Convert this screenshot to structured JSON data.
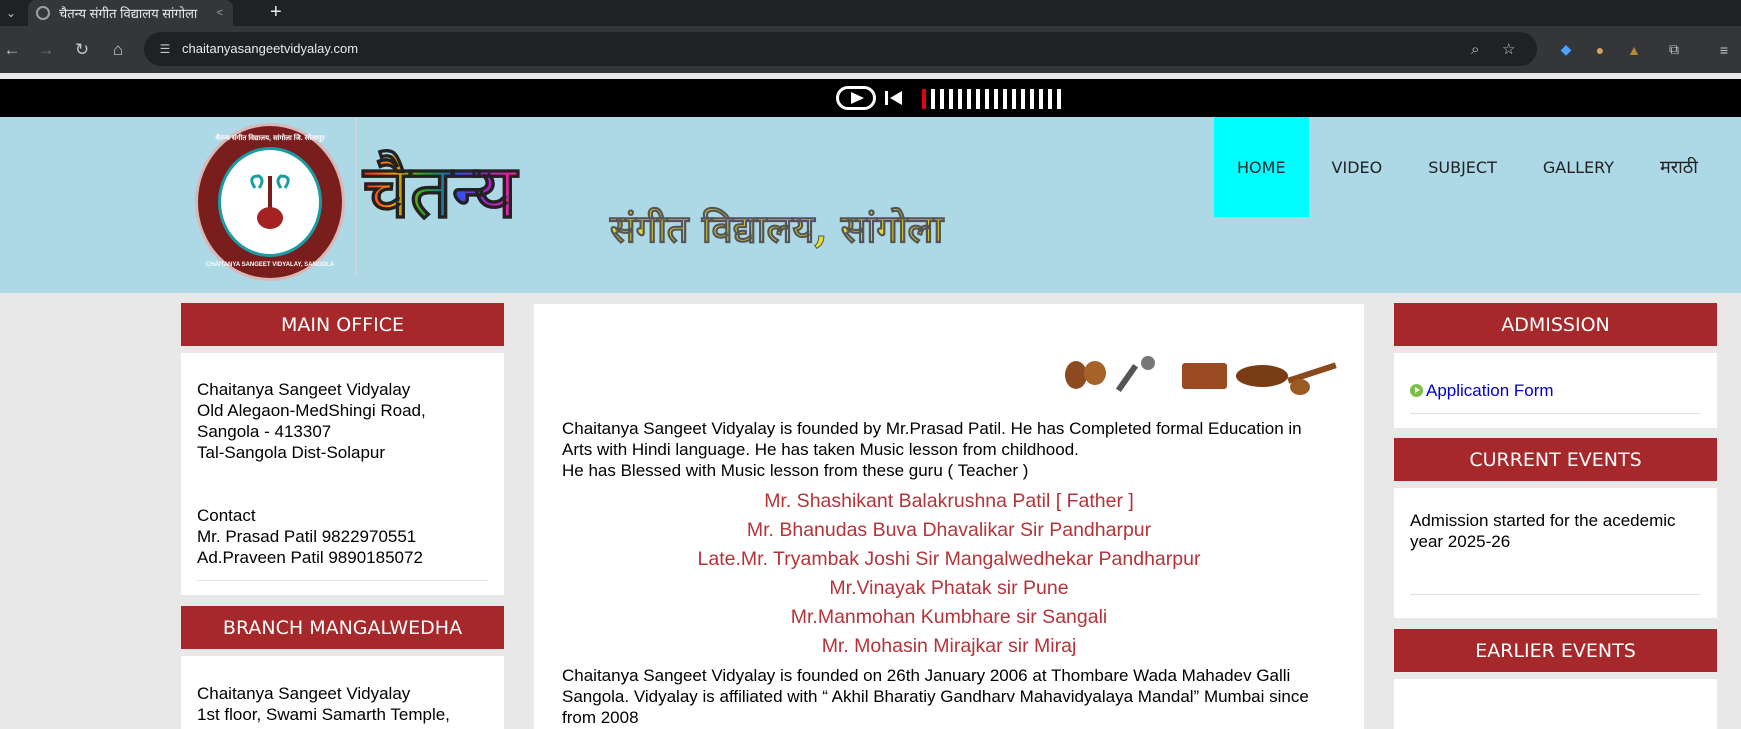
{
  "browser": {
    "tab_title": "चैतन्य संगीत विद्यालय सांगोला",
    "url": "chaitanyasangeetvidyalay.com"
  },
  "header": {
    "brand_title": "चैतन्य",
    "brand_subtitle": "संगीत विद्यालय, सांगोला",
    "logo_text_top": "चैतन्य संगीत विद्यालय, सांगोला जि. सोलापूर",
    "logo_text_bottom": "CHAITANYA SANGEET VIDYALAY, SANGOLA",
    "nav": [
      {
        "label": "HOME",
        "active": true
      },
      {
        "label": "VIDEO"
      },
      {
        "label": "SUBJECT"
      },
      {
        "label": "GALLERY"
      },
      {
        "label": "मराठी"
      }
    ]
  },
  "audio_player": {
    "volume_level": 1,
    "volume_steps": 16
  },
  "main_office": {
    "heading": "MAIN OFFICE",
    "address_lines": [
      "Chaitanya Sangeet Vidyalay",
      "Old Alegaon-MedShingi Road,",
      "Sangola - 413307",
      "Tal-Sangola Dist-Solapur"
    ],
    "contact_heading": "Contact",
    "contacts": [
      "Mr. Prasad Patil 9822970551",
      "Ad.Praveen Patil 9890185072"
    ]
  },
  "branch": {
    "heading": "BRANCH MANGALWEDHA",
    "address_lines": [
      "Chaitanya Sangeet Vidyalay",
      "1st floor, Swami Samarth Temple,"
    ]
  },
  "content": {
    "intro": [
      "Chaitanya Sangeet Vidyalay is founded by Mr.Prasad Patil. He has Completed formal Education in",
      "Arts with Hindi language. He has taken Music lesson from childhood.",
      "He has Blessed with Music lesson from these guru ( Teacher )"
    ],
    "gurus": [
      "Mr. Shashikant Balakrushna Patil [ Father ]",
      "Mr. Bhanudas Buva Dhavalikar Sir Pandharpur",
      "Late.Mr. Tryambak Joshi Sir Mangalwedhekar Pandharpur",
      "Mr.Vinayak Phatak sir Pune",
      "Mr.Manmohan Kumbhare sir Sangali",
      "Mr. Mohasin Mirajkar sir Miraj"
    ],
    "history": [
      "Chaitanya Sangeet Vidyalay is founded on 26th January 2006 at Thombare Wada Mahadev Galli",
      "Sangola. Vidyalay is affiliated with “ Akhil Bharatiy Gandharv Mahavidyalaya Mandal” Mumbai since",
      "from 2008"
    ]
  },
  "admission": {
    "heading": "ADMISSION",
    "link": "Application Form"
  },
  "current_events": {
    "heading": "CURRENT EVENTS",
    "text": "Admission started for the acedemic year 2025-26"
  },
  "earlier_events": {
    "heading": "EARLIER EVENTS"
  },
  "colors": {
    "panel_header": "#a6282a",
    "header_bg": "#add8e6",
    "nav_active": "#00ffff",
    "guru_text": "#b4343a"
  }
}
